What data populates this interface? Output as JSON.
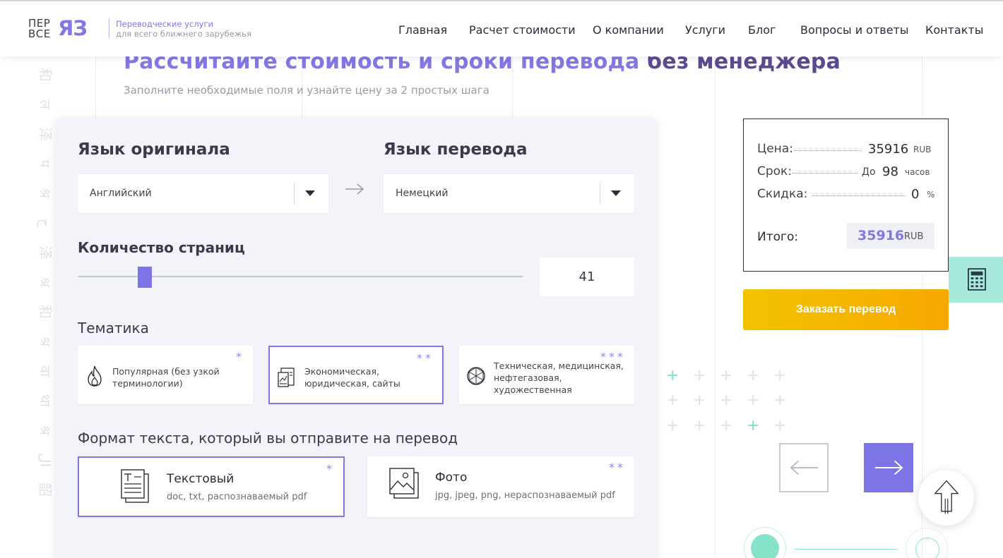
{
  "header": {
    "logo_small_1": "ПЕР",
    "logo_small_2": "ВСЕ",
    "logo_big": "ЯЗ",
    "tagline_1": "Переводческие услуги",
    "tagline_2": "для всего ближнего зарубежья",
    "nav": [
      "Главная",
      "Расчет стоимости",
      "О компании",
      "Услуги",
      "Блог",
      "Вопросы и ответы",
      "Контакты"
    ]
  },
  "left_glyphs": [
    "和",
    "ल",
    "泽",
    "प",
    "श्र",
    "ج",
    "泽",
    "श्र",
    "和",
    "श्र",
    "वा",
    "था",
    "श्र",
    "ال",
    "韶"
  ],
  "page": {
    "title_1": "Рассчитайте стоимость и сроки перевода",
    "title_2": "без менеджера",
    "subtitle": "Заполните необходимые поля и узнайте цену за 2 простых шага"
  },
  "form": {
    "source_label": "Язык оригинала",
    "source_value": "Английский",
    "target_label": "Язык перевода",
    "target_value": "Немецкий",
    "pages_label": "Количество страниц",
    "pages_value": "41",
    "pages_slider_fraction": 0.15,
    "theme_label": "Тематика",
    "themes": [
      {
        "text": "Популярная (без узкой терминологии)",
        "stars": "*"
      },
      {
        "text": "Экономическая, юридическая, сайты",
        "stars": "**"
      },
      {
        "text": "Техническая, медицинская, нефтегазовая, художественная",
        "stars": "***"
      }
    ],
    "format_label": "Формат текста, который вы отправите на перевод",
    "formats": [
      {
        "title": "Текстовый",
        "sub": "doc, txt, распознаваемый pdf",
        "stars": "*"
      },
      {
        "title": "Фото",
        "sub": "jpg, jpeg, png, нераспознаваемый pdf",
        "stars": "**"
      }
    ]
  },
  "summary": {
    "price_label": "Цена:",
    "price_value": "35916",
    "price_unit": "RUB",
    "term_label": "Срок:",
    "term_prefix": "До",
    "term_value": "98",
    "term_unit": "часов",
    "discount_label": "Скидка:",
    "discount_value": "0",
    "discount_unit": "%",
    "total_label": "Итого:",
    "total_value": "35916",
    "total_unit": "RUB"
  },
  "order_button": "Заказать перевод",
  "colors": {
    "accent": "#8277e4",
    "order_from": "#f2c400",
    "order_to": "#f6a800",
    "mint": "#a7eadb"
  }
}
